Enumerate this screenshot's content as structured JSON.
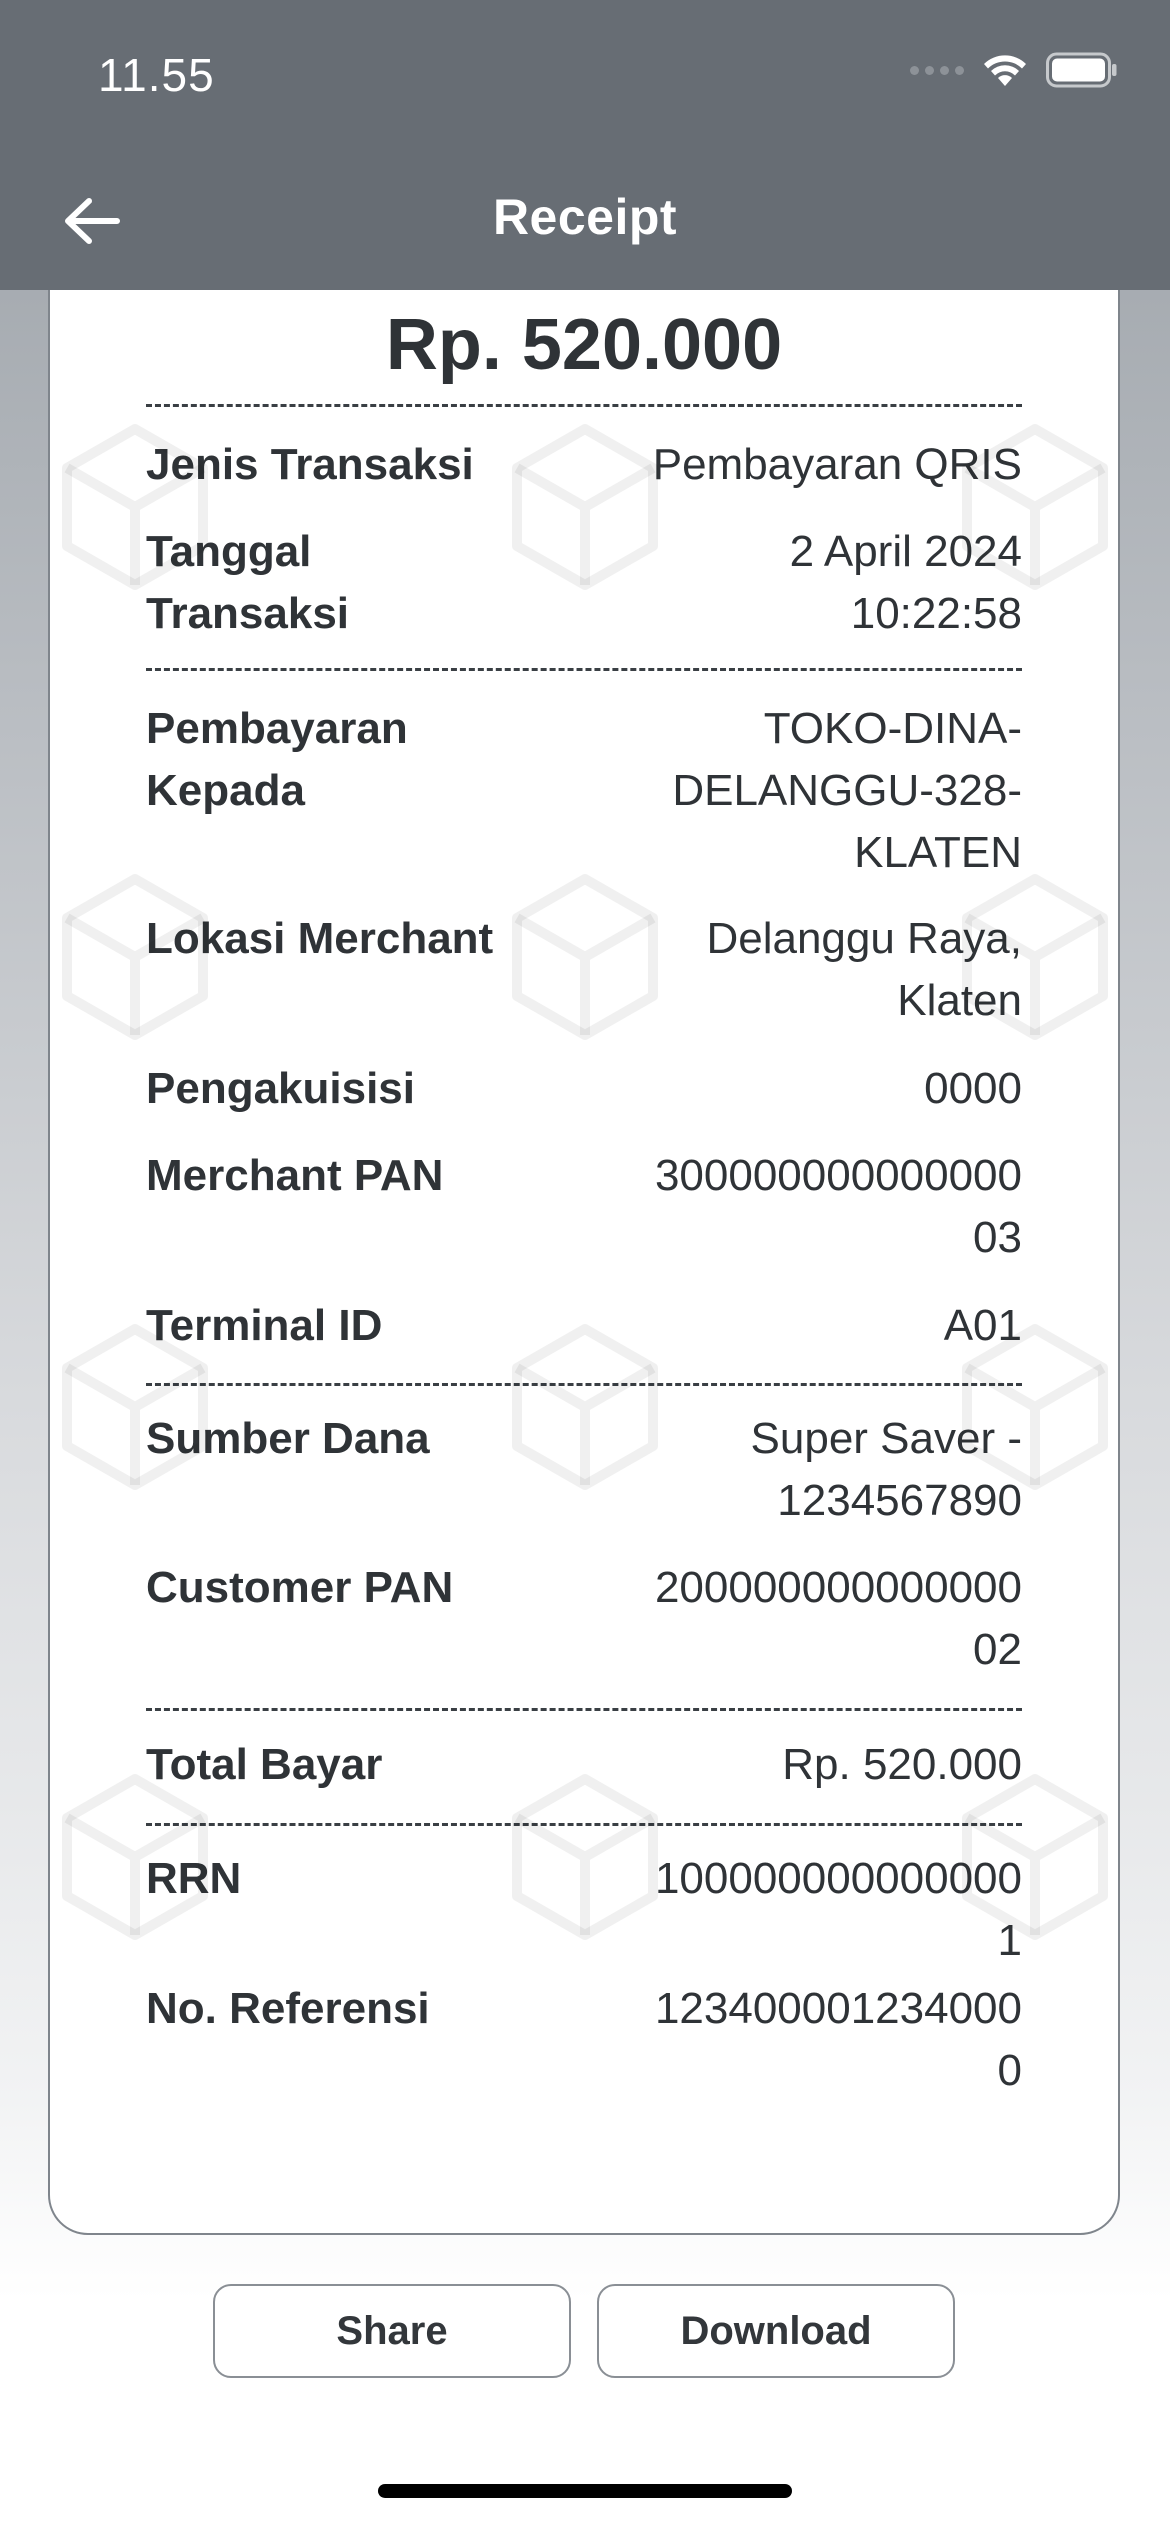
{
  "status_bar": {
    "time": "11.55"
  },
  "header": {
    "title": "Receipt"
  },
  "receipt": {
    "amount": "Rp. 520.000",
    "rows": [
      {
        "label": "Jenis Transaksi",
        "value": "Pembayaran QRIS"
      },
      {
        "label": "Tanggal Transaksi",
        "value": "2 April 2024\n10:22:58"
      },
      {
        "label": "Pembayaran Kepada",
        "value": "TOKO-DINA-\nDELANGGU-328-\nKLATEN"
      },
      {
        "label": "Lokasi Merchant",
        "value": "Delanggu Raya,\nKlaten"
      },
      {
        "label": "Pengakuisisi",
        "value": "0000"
      },
      {
        "label": "Merchant PAN",
        "value": "300000000000000\n03"
      },
      {
        "label": "Terminal ID",
        "value": "A01"
      },
      {
        "label": "Sumber Dana",
        "value": "Super Saver -\n1234567890"
      },
      {
        "label": "Customer PAN",
        "value": "200000000000000\n02"
      },
      {
        "label": "Total Bayar",
        "value": "Rp. 520.000"
      },
      {
        "label": "RRN",
        "value": "100000000000000\n1"
      },
      {
        "label": "No. Referensi",
        "value": "123400001234000\n0"
      }
    ]
  },
  "actions": {
    "share_label": "Share",
    "download_label": "Download"
  },
  "icons": {
    "back": "arrow-left-icon",
    "wifi": "wifi-icon",
    "battery": "battery-icon",
    "signal": "cellular-signal-icon",
    "watermark": "cube-icon"
  },
  "colors": {
    "header_bg": "#676d74",
    "text": "#2f3337"
  }
}
